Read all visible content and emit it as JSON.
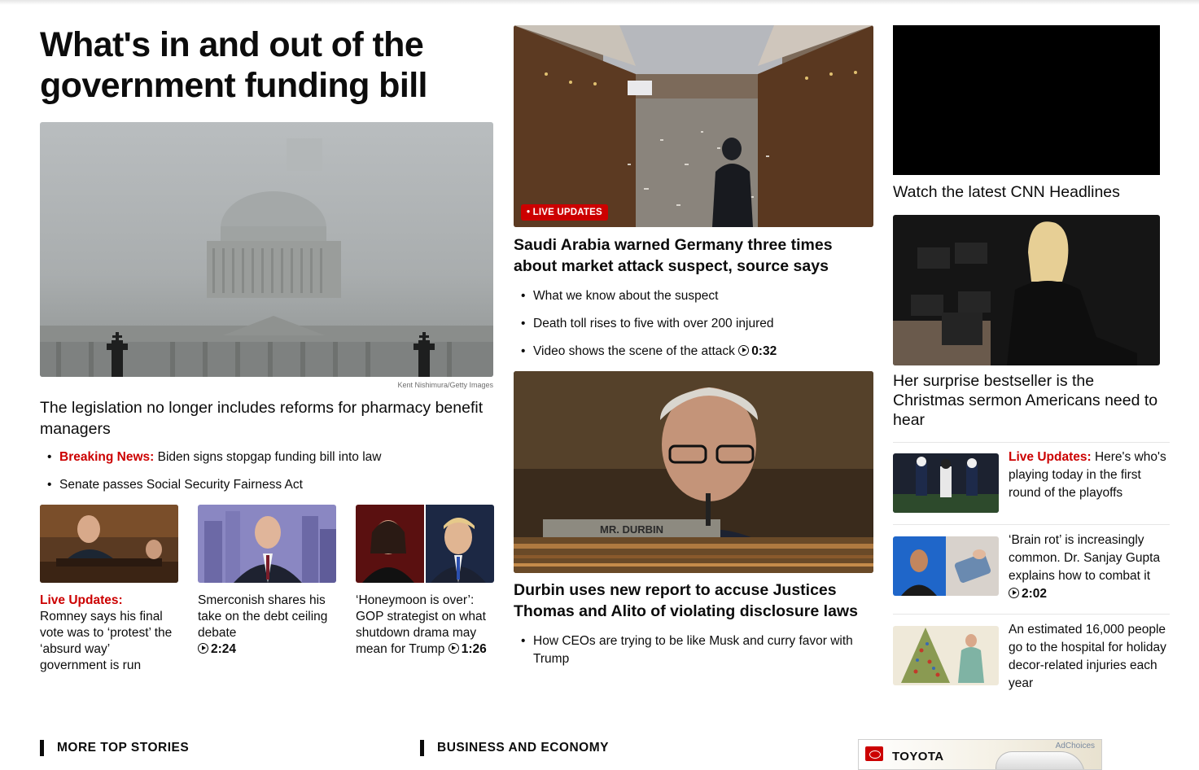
{
  "lead": {
    "headline": "What's in and out of the government funding bill",
    "image_credit": "Kent Nishimura/Getty Images",
    "lede": "The legislation no longer includes reforms for pharmacy benefit managers",
    "bullets": [
      {
        "prefix": "Breaking News:",
        "text": "Biden signs stopgap funding bill into law"
      },
      {
        "prefix": "",
        "text": "Senate passes Social Security Fairness Act"
      }
    ]
  },
  "cards": [
    {
      "prefix": "Live Updates:",
      "text": "Romney says his final vote was to ‘protest’ the ‘absurd way’ government is run",
      "duration": ""
    },
    {
      "prefix": "",
      "text": "Smerconish shares his take on the debt ceiling debate",
      "duration": "2:24"
    },
    {
      "prefix": "",
      "text": "‘Honeymoon is over’: GOP strategist on what shutdown drama may mean for Trump",
      "duration": "1:26"
    }
  ],
  "middle": {
    "badge": "• LIVE UPDATES",
    "headline": "Saudi Arabia warned Germany three times about market attack suspect, source says",
    "bullets": [
      {
        "text": "What we know about the suspect",
        "duration": ""
      },
      {
        "text": "Death toll rises to five with over 200 injured",
        "duration": ""
      },
      {
        "text": "Video shows the scene of the attack",
        "duration": "0:32"
      }
    ],
    "second_headline": "Durbin uses new report to accuse Justices Thomas and Alito of violating disclosure laws",
    "second_bullets": [
      {
        "text": "How CEOs are trying to be like Musk and curry favor with Trump"
      }
    ],
    "nameplate": "MR. DURBIN"
  },
  "right": {
    "video_title": "Watch the latest CNN Headlines",
    "feature_headline": "Her surprise bestseller is the Christmas sermon Americans need to hear",
    "stories": [
      {
        "prefix": "Live Updates:",
        "text": "Here's who's playing today in the first round of the playoffs",
        "duration": ""
      },
      {
        "prefix": "",
        "text": "‘Brain rot’ is increasingly common. Dr. Sanjay Gupta explains how to combat it",
        "duration": "2:02"
      },
      {
        "prefix": "",
        "text": "An estimated 16,000 people go to the hospital for holiday decor-related injuries each year",
        "duration": ""
      }
    ]
  },
  "sections": {
    "left": "MORE TOP STORIES",
    "middle": "BUSINESS AND ECONOMY"
  },
  "ad": {
    "brand": "TOYOTA",
    "choices": "AdChoices"
  }
}
